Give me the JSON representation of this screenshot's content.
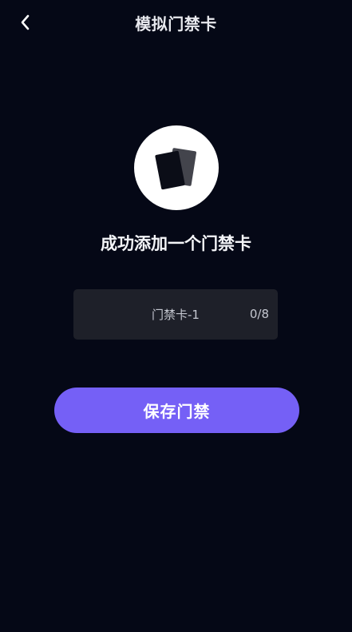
{
  "header": {
    "title": "模拟门禁卡",
    "back_icon": "chevron-left-icon"
  },
  "hero": {
    "icon": "cards-icon",
    "message": "成功添加一个门禁卡"
  },
  "card_name": {
    "value": "门禁卡-1",
    "counter": "0/8"
  },
  "actions": {
    "save_label": "保存门禁"
  },
  "colors": {
    "background": "#050816",
    "accent": "#7560f6",
    "field_background": "#1e2029"
  }
}
